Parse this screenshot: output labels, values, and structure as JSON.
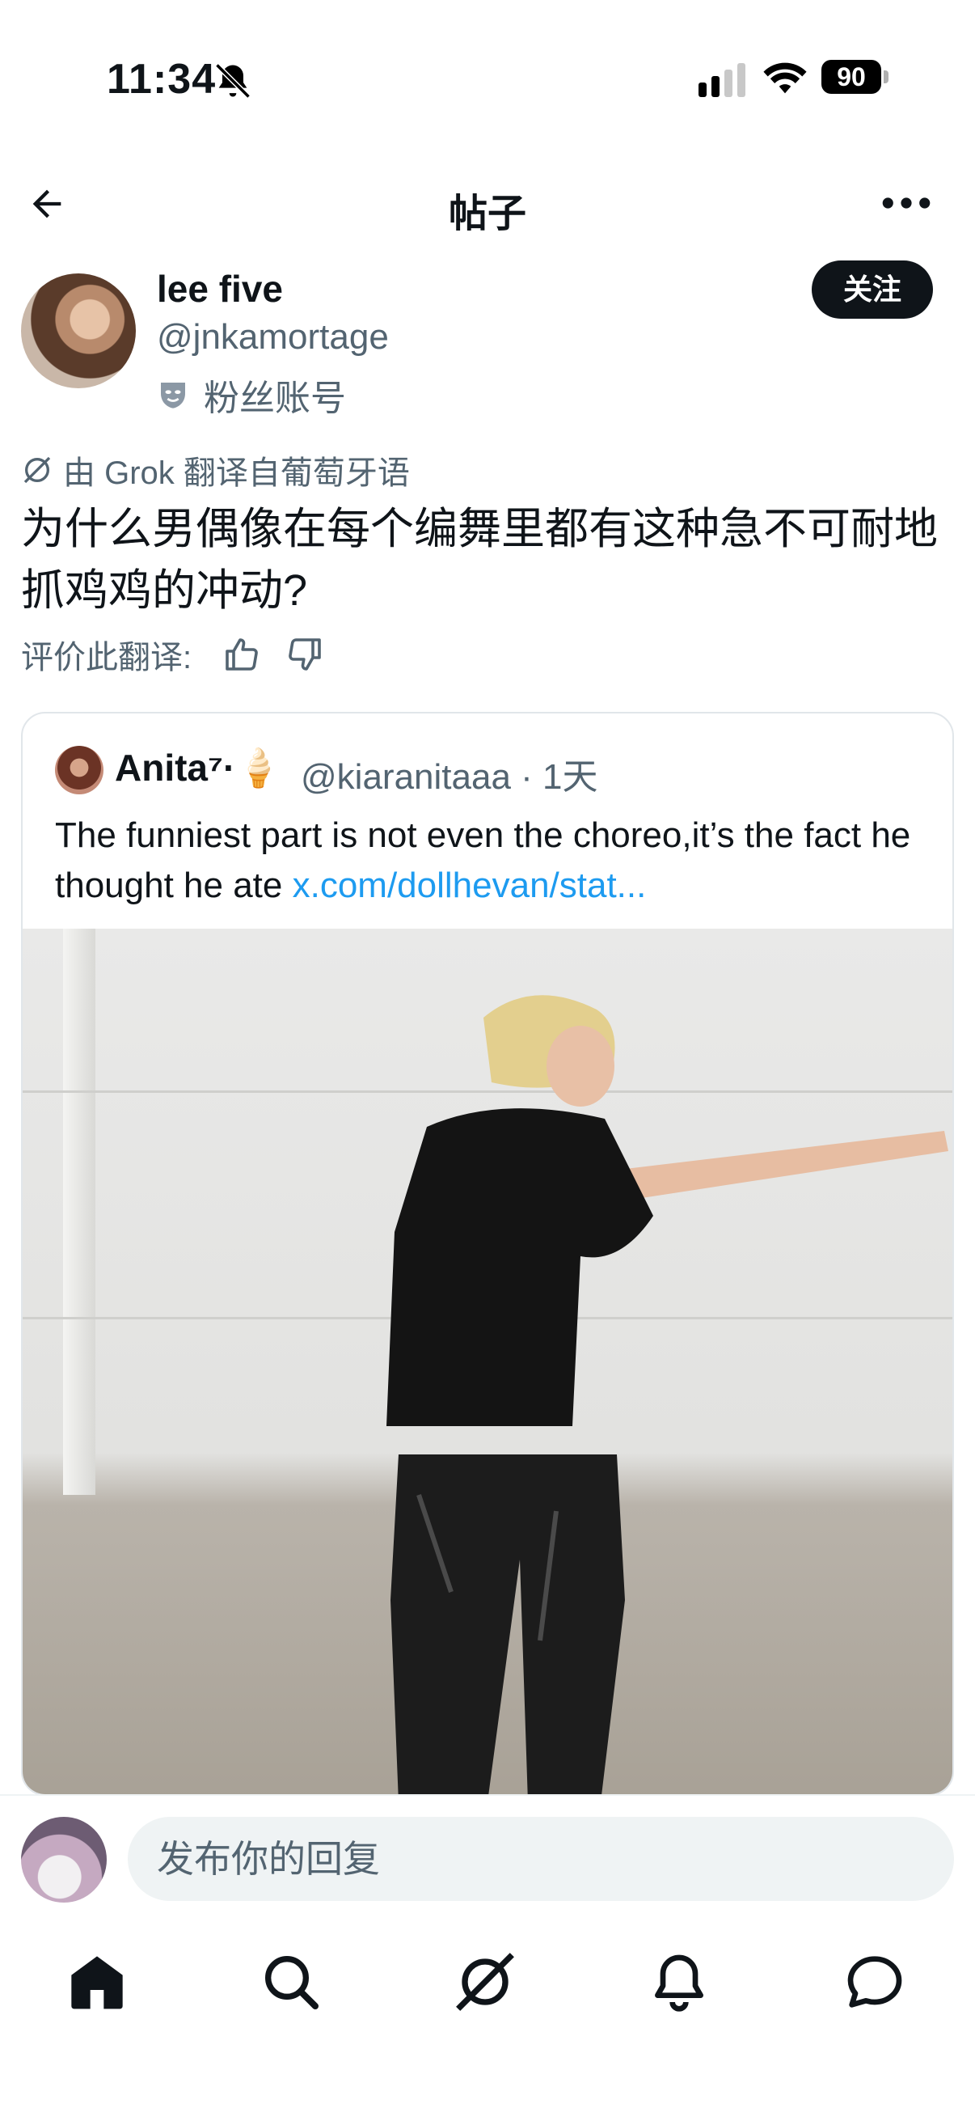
{
  "status_bar": {
    "time": "11:34",
    "battery": "90"
  },
  "header": {
    "title": "帖子"
  },
  "post": {
    "author_name": "lee five",
    "author_handle": "@jnkamortage",
    "badge": "粉丝账号",
    "follow_label": "关注",
    "translated_note": "由 Grok 翻译自葡萄牙语",
    "text": "为什么男偶像在每个编舞里都有这种急不可耐地抓鸡鸡的冲动?",
    "rate_label": "评价此翻译:"
  },
  "quote": {
    "author_name": "Anita⁷·🍦",
    "author_handle": "@kiaranitaaa · 1天",
    "text": "The funniest part is not even the choreo,it’s the fact he thought he ate ",
    "link": "x.com/dollhevan/stat..."
  },
  "reply": {
    "placeholder": "发布你的回复"
  },
  "nav": {
    "items": [
      "home-icon",
      "search-icon",
      "grok-icon",
      "notifications-icon",
      "messages-icon"
    ]
  }
}
